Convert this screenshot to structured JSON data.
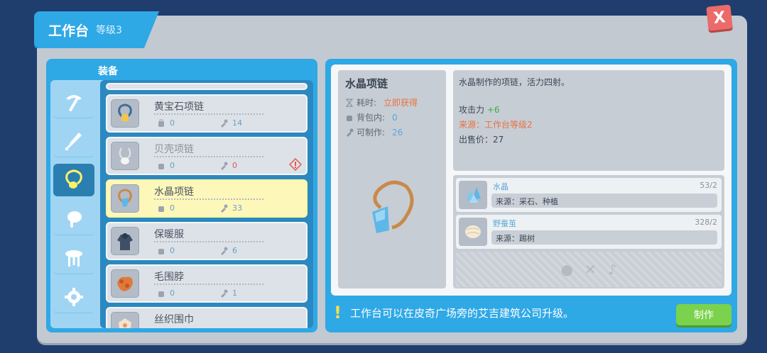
{
  "window": {
    "title": "工作台",
    "level": "等级3",
    "close_label": "X"
  },
  "left": {
    "section_label": "装备",
    "categories": [
      {
        "icon": "pickaxe-icon"
      },
      {
        "icon": "sword-icon"
      },
      {
        "icon": "necklace-icon"
      },
      {
        "icon": "drumstick-icon"
      },
      {
        "icon": "stool-icon"
      },
      {
        "icon": "gear-icon"
      }
    ],
    "items": [
      {
        "name": "黄宝石项链",
        "bag": "0",
        "craft": "14"
      },
      {
        "name": "贝壳项链",
        "bag": "0",
        "craft": "0"
      },
      {
        "name": "水晶项链",
        "bag": "0",
        "craft": "33"
      },
      {
        "name": "保暖服",
        "bag": "0",
        "craft": "6"
      },
      {
        "name": "毛围脖",
        "bag": "0",
        "craft": "1"
      },
      {
        "name": "丝织围巾"
      }
    ]
  },
  "detail": {
    "name": "水晶项链",
    "time_label": "耗时:",
    "time_value": "立即获得",
    "bag_label": "背包内:",
    "bag_value": "0",
    "craft_label": "可制作:",
    "craft_value": "26",
    "description": "水晶制作的项链，活力四射。",
    "attack_label": "攻击力",
    "attack_value": "+6",
    "source": "来源：工作台等级2",
    "price": "出售价：27"
  },
  "materials": [
    {
      "name": "水晶",
      "count": "53/2",
      "source": "来源：采石、种植"
    },
    {
      "name": "野蚕茧",
      "count": "328/2",
      "source": "来源：踢树"
    }
  ],
  "footer": {
    "tip": "工作台可以在皮奇广场旁的艾吉建筑公司升级。",
    "tip_mark": "!",
    "make_label": "制作"
  },
  "colors": {
    "accent": "#2fa8e6",
    "make_button": "#7bd24c",
    "close_button": "#ec6a6a",
    "selected_item": "#fdf7b9"
  }
}
